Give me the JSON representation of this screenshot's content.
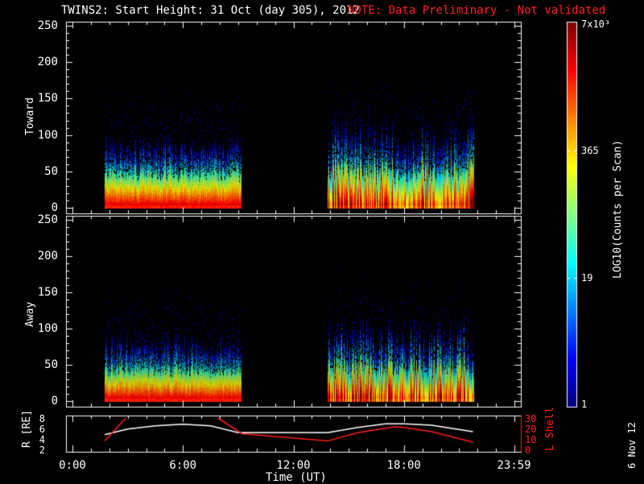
{
  "header": {
    "title": "TWINS2: Start Height: 31 Oct (day 305), 2012",
    "note": "NOTE: Data Preliminary - Not validated"
  },
  "colors": {
    "note": "#ff2020",
    "r_line": "#ffffff",
    "lshell_line": "#ff2020"
  },
  "date_stamp": "6 Nov 12",
  "chart_data": [
    {
      "type": "heatmap",
      "name": "Toward",
      "ylabel": "Toward",
      "ylim": [
        0,
        250
      ],
      "yticks": [
        "0",
        "50",
        "100",
        "150",
        "200",
        "250"
      ],
      "xlim_hours": [
        0,
        24
      ],
      "data_intervals_hours": [
        [
          1.75,
          9.15
        ],
        [
          13.85,
          21.75
        ]
      ],
      "typical_max_height": [
        100,
        110
      ]
    },
    {
      "type": "heatmap",
      "name": "Away",
      "ylabel": "Away",
      "ylim": [
        0,
        250
      ],
      "yticks": [
        "0",
        "50",
        "100",
        "150",
        "200",
        "250"
      ],
      "xlim_hours": [
        0,
        24
      ],
      "data_intervals_hours": [
        [
          1.75,
          9.15
        ],
        [
          13.85,
          21.75
        ]
      ],
      "typical_max_height": [
        90,
        100
      ]
    },
    {
      "type": "line",
      "name": "orbit",
      "ylabel_left": "R [RE]",
      "ylim_left": [
        2,
        8
      ],
      "yticks_left": [
        "2",
        "4",
        "6",
        "8"
      ],
      "ylabel_right": "L Shell",
      "ylim_right": [
        0,
        30
      ],
      "yticks_right": [
        "0",
        "10",
        "20",
        "30"
      ],
      "xlabel": "Time (UT)",
      "xticks": [
        "0:00",
        "6:00",
        "12:00",
        "18:00",
        "23:59"
      ],
      "series": [
        {
          "name": "R",
          "axis": "left",
          "x": [
            1.75,
            3,
            4.5,
            6,
            7.5,
            9,
            12,
            13.85,
            15.5,
            17,
            18,
            19.5,
            21.75
          ],
          "y": [
            4.8,
            5.9,
            6.5,
            6.8,
            6.5,
            5.2,
            5.2,
            5.2,
            6.2,
            6.9,
            6.9,
            6.6,
            5.4
          ]
        },
        {
          "name": "L Shell",
          "axis": "right",
          "x": [
            1.75,
            2.9,
            null,
            7.9,
            9.2,
            13.85,
            15.5,
            17.5,
            18,
            19.5,
            21.75
          ],
          "y": [
            8,
            30,
            null,
            30,
            15,
            8,
            16,
            21.5,
            21,
            17,
            7
          ]
        }
      ]
    },
    {
      "type": "colorbar",
      "label": "LOG10(Counts per Scan)",
      "ticks": [
        "1",
        "19",
        "365",
        "7x10³"
      ],
      "range": [
        1,
        7000
      ]
    }
  ]
}
